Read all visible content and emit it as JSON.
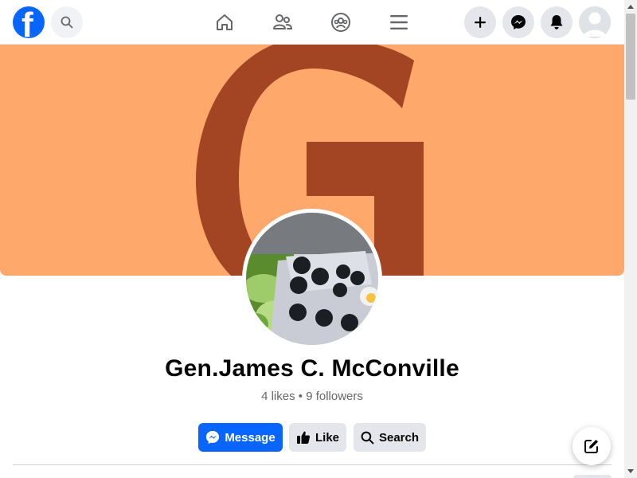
{
  "nav": {
    "logo_icon": "facebook-logo-icon",
    "logo_letter": "f",
    "search_icon": "search-icon",
    "center_icons": [
      "home-icon",
      "friends-icon",
      "groups-icon",
      "menu-icon"
    ],
    "right_icons": [
      "plus-icon",
      "messenger-icon",
      "bell-icon",
      "avatar-icon"
    ]
  },
  "cover": {
    "letter": "G",
    "background_color": "#ffa86c",
    "letter_color": "#a34423"
  },
  "profile": {
    "name": "Gen.James C. McConville",
    "stats": "4 likes • 9 followers"
  },
  "actions": {
    "message_label": "Message",
    "like_label": "Like",
    "search_label": "Search"
  },
  "fab": {
    "icon": "compose-icon"
  },
  "colors": {
    "brand": "#0866ff",
    "cover": "#ffa86c",
    "cover_letter": "#a34423"
  }
}
